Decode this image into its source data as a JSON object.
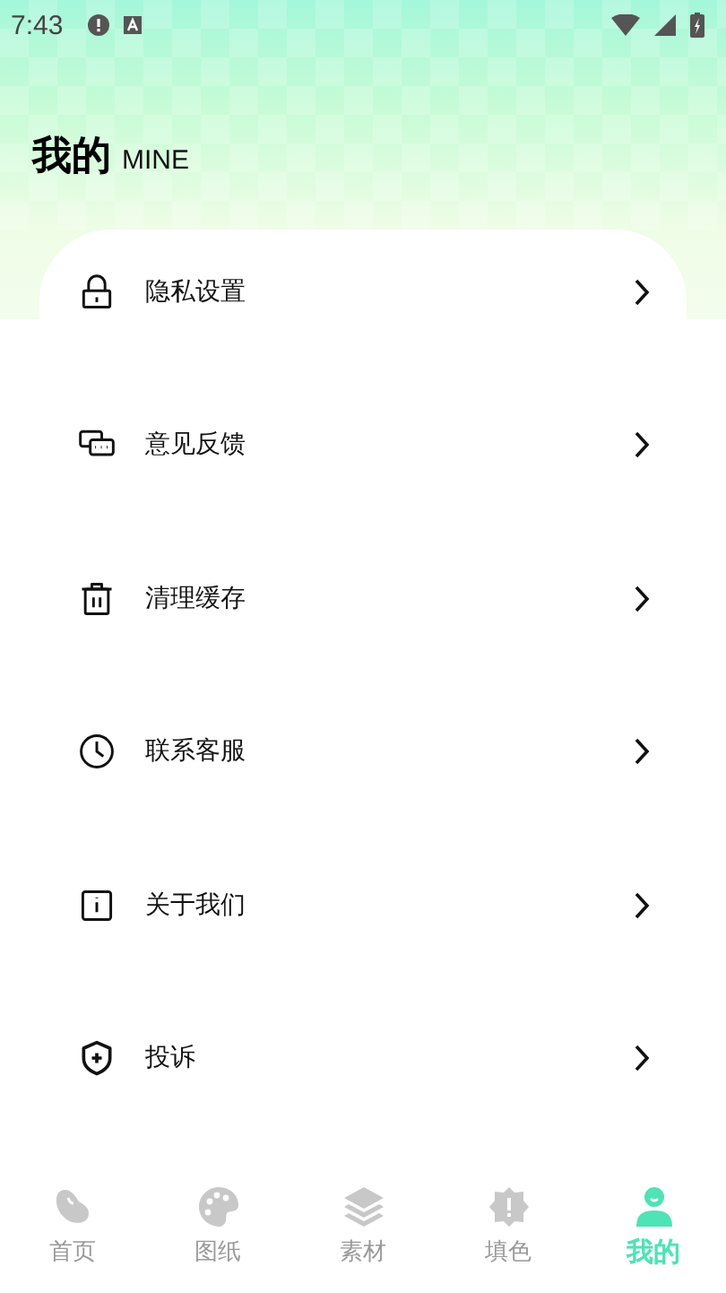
{
  "status_bar": {
    "time": "7:43"
  },
  "header": {
    "title": "我的",
    "subtitle": "MINE"
  },
  "menu": [
    {
      "kind": "lock",
      "label": "隐私设置"
    },
    {
      "kind": "chat",
      "label": "意见反馈"
    },
    {
      "kind": "trash",
      "label": "清理缓存"
    },
    {
      "kind": "clock",
      "label": "联系客服"
    },
    {
      "kind": "info",
      "label": "关于我们"
    },
    {
      "kind": "shield",
      "label": "投诉"
    }
  ],
  "tab_bar": [
    {
      "kind": "bean",
      "label": "首页",
      "selected": false
    },
    {
      "kind": "palette",
      "label": "图纸",
      "selected": false
    },
    {
      "kind": "layers",
      "label": "素材",
      "selected": false
    },
    {
      "kind": "badge",
      "label": "填色",
      "selected": false
    },
    {
      "kind": "person",
      "label": "我的",
      "selected": true
    }
  ]
}
